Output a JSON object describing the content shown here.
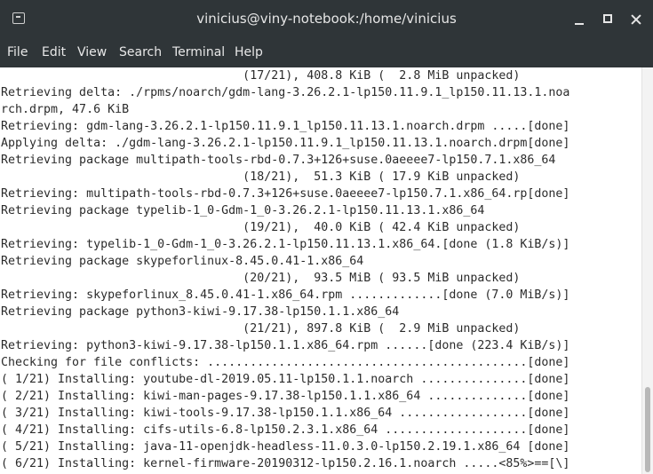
{
  "window": {
    "title": "vinicius@viny-notebook:/home/vinicius",
    "icon": "terminal-icon"
  },
  "menu": [
    "File",
    "Edit",
    "View",
    "Search",
    "Terminal",
    "Help"
  ],
  "terminal": {
    "lines": [
      "                                  (17/21), 408.8 KiB (  2.8 MiB unpacked)",
      "Retrieving delta: ./rpms/noarch/gdm-lang-3.26.2.1-lp150.11.9.1_lp150.11.13.1.noa",
      "rch.drpm, 47.6 KiB",
      "Retrieving: gdm-lang-3.26.2.1-lp150.11.9.1_lp150.11.13.1.noarch.drpm .....[done]",
      "Applying delta: ./gdm-lang-3.26.2.1-lp150.11.9.1_lp150.11.13.1.noarch.drpm[done]",
      "Retrieving package multipath-tools-rbd-0.7.3+126+suse.0aeeee7-lp150.7.1.x86_64",
      "                                  (18/21),  51.3 KiB ( 17.9 KiB unpacked)",
      "Retrieving: multipath-tools-rbd-0.7.3+126+suse.0aeeee7-lp150.7.1.x86_64.rp[done]",
      "Retrieving package typelib-1_0-Gdm-1_0-3.26.2.1-lp150.11.13.1.x86_64",
      "                                  (19/21),  40.0 KiB ( 42.4 KiB unpacked)",
      "Retrieving: typelib-1_0-Gdm-1_0-3.26.2.1-lp150.11.13.1.x86_64.[done (1.8 KiB/s)]",
      "Retrieving package skypeforlinux-8.45.0.41-1.x86_64",
      "                                  (20/21),  93.5 MiB ( 93.5 MiB unpacked)",
      "Retrieving: skypeforlinux_8.45.0.41-1.x86_64.rpm .............[done (7.0 MiB/s)]",
      "Retrieving package python3-kiwi-9.17.38-lp150.1.1.x86_64",
      "                                  (21/21), 897.8 KiB (  2.9 MiB unpacked)",
      "Retrieving: python3-kiwi-9.17.38-lp150.1.1.x86_64.rpm ......[done (223.4 KiB/s)]",
      "Checking for file conflicts: .............................................[done]",
      "( 1/21) Installing: youtube-dl-2019.05.11-lp150.1.1.noarch ...............[done]",
      "( 2/21) Installing: kiwi-man-pages-9.17.38-lp150.1.1.x86_64 ..............[done]",
      "( 3/21) Installing: kiwi-tools-9.17.38-lp150.1.1.x86_64 ..................[done]",
      "( 4/21) Installing: cifs-utils-6.8-lp150.2.3.1.x86_64 ....................[done]",
      "( 5/21) Installing: java-11-openjdk-headless-11.0.3.0-lp150.2.19.1.x86_64 [done]",
      "( 6/21) Installing: kernel-firmware-20190312-lp150.2.16.1.noarch .....<85%>==[\\]"
    ]
  }
}
